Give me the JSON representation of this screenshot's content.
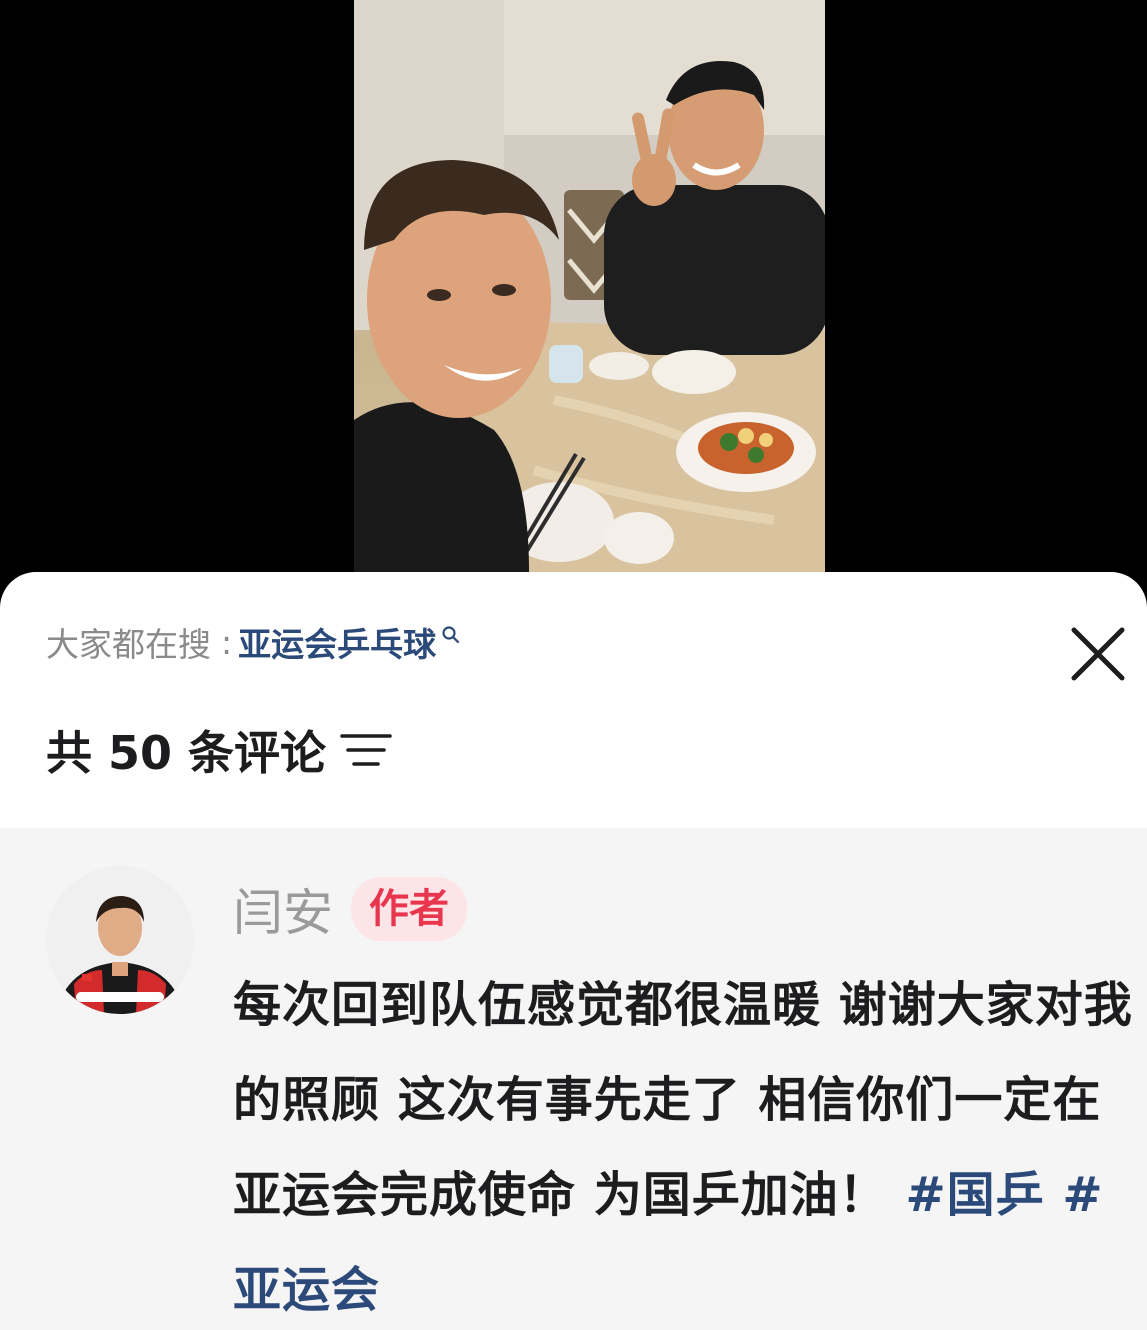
{
  "hot_search": {
    "label": "大家都在搜",
    "colon": ":",
    "term": "亚运会乒乓球"
  },
  "comments_header": {
    "title": "共 50 条评论"
  },
  "comment": {
    "author": "闫安",
    "badge": "作者",
    "text": "每次回到队伍感觉都很温暖 谢谢大家对我的照顾 这次有事先走了 相信你们一定在亚运会完成使命 为国乒加油！",
    "hashtags": [
      "#国乒",
      "#亚运会"
    ]
  },
  "colors": {
    "link": "#2b4a79",
    "badge_text": "#e8364f",
    "badge_bg": "#fde4e7",
    "muted": "#8a8a8a",
    "comment_bg": "#f5f5f5"
  },
  "icons": [
    "search-icon",
    "close-icon",
    "sort-filter-icon"
  ]
}
